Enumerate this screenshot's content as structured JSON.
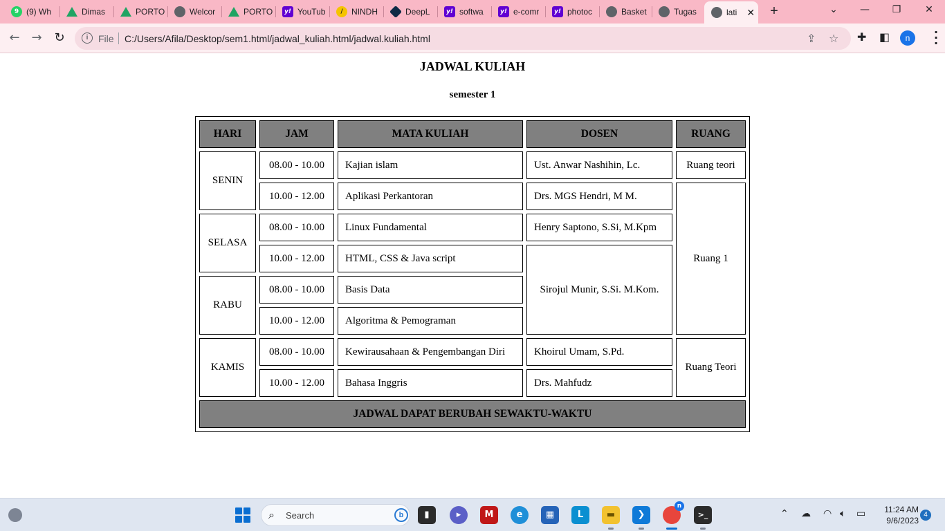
{
  "browser": {
    "tabs": [
      {
        "title": "(9) Wh",
        "icon": "whatsapp-icon",
        "badge": "9"
      },
      {
        "title": "Dimas",
        "icon": "google-drive-icon"
      },
      {
        "title": "PORTO",
        "icon": "google-drive-icon"
      },
      {
        "title": "Welcor",
        "icon": "globe-icon"
      },
      {
        "title": "PORTO",
        "icon": "google-drive-icon"
      },
      {
        "title": "YouTub",
        "icon": "yahoo-icon"
      },
      {
        "title": "NINDH",
        "icon": "nindh-icon"
      },
      {
        "title": "DeepL",
        "icon": "deepl-icon"
      },
      {
        "title": "softwa",
        "icon": "yahoo-icon"
      },
      {
        "title": "e-comr",
        "icon": "yahoo-icon"
      },
      {
        "title": "photoc",
        "icon": "yahoo-icon"
      },
      {
        "title": "Basket",
        "icon": "globe-icon"
      },
      {
        "title": "Tugas",
        "icon": "globe-icon"
      }
    ],
    "active_tab": {
      "title": "lati",
      "icon": "globe-icon"
    },
    "address": {
      "scheme_label": "File",
      "url": "C:/Users/Afila/Desktop/sem1.html/jadwal_kuliah.html/jadwal.kuliah.html"
    },
    "profile_initial": "n"
  },
  "page": {
    "title": "JADWAL KULIAH",
    "subtitle": "semester 1",
    "headers": {
      "hari": "HARI",
      "jam": "JAM",
      "mata_kuliah": "MATA KULIAH",
      "dosen": "DOSEN",
      "ruang": "RUANG"
    },
    "days": {
      "senin": "SENIN",
      "selasa": "SELASA",
      "rabu": "RABU",
      "kamis": "KAMIS"
    },
    "rows": [
      {
        "jam": "08.00 - 10.00",
        "mata_kuliah": "Kajian islam",
        "dosen": "Ust. Anwar Nashihin, Lc.",
        "ruang": "Ruang teori"
      },
      {
        "jam": "10.00 - 12.00",
        "mata_kuliah": "Aplikasi Perkantoran",
        "dosen": "Drs. MGS Hendri, M M.",
        "ruang": "Ruang 1"
      },
      {
        "jam": "08.00 - 10.00",
        "mata_kuliah": "Linux Fundamental",
        "dosen": "Henry Saptono, S.Si, M.Kpm"
      },
      {
        "jam": "10.00 - 12.00",
        "mata_kuliah": "HTML, CSS & Java script",
        "dosen": "Sirojul Munir, S.Si. M.Kom."
      },
      {
        "jam": "08.00 - 10.00",
        "mata_kuliah": "Basis Data"
      },
      {
        "jam": "10.00 - 12.00",
        "mata_kuliah": "Algoritma & Pemograman"
      },
      {
        "jam": "08.00 - 10.00",
        "mata_kuliah": "Kewirausahaan & Pengembangan Diri",
        "dosen": "Khoirul Umam, S.Pd.",
        "ruang": "Ruang Teori"
      },
      {
        "jam": "10.00 - 12.00",
        "mata_kuliah": "Bahasa Inggris",
        "dosen": "Drs. Mahfudz"
      }
    ],
    "footer_note": "JADWAL DAPAT BERUBAH SEWAKTU-WAKTU"
  },
  "taskbar": {
    "search_placeholder": "Search",
    "apps": [
      "file-explorer-icon",
      "meet-icon",
      "mcafee-icon",
      "edge-icon",
      "store-icon",
      "l-app-icon",
      "folder-icon",
      "vscode-icon",
      "chrome-icon",
      "terminal-icon"
    ],
    "chrome_badge": "n",
    "time": "11:24 AM",
    "date": "9/6/2023",
    "notification_count": "4"
  },
  "colors": {
    "tabbar_bg": "#f9b8c6",
    "toolbar_bg": "#fdeff2",
    "table_header_bg": "#808080",
    "taskbar_bg": "#dfe6f1"
  }
}
